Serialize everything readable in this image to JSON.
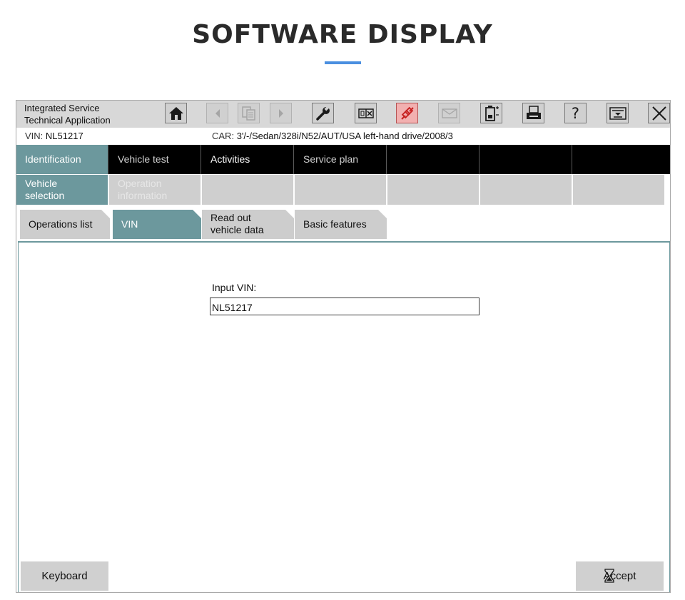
{
  "heading": "SOFTWARE DISPLAY",
  "app": {
    "title_line1": "Integrated Service",
    "title_line2": "Technical Application"
  },
  "toolbar": {
    "icons": [
      "home-icon",
      "back-icon",
      "documents-icon",
      "forward-icon",
      "wrench-icon",
      "window-close-icon",
      "connection-icon",
      "mail-icon",
      "battery-icon",
      "printer-icon",
      "help-icon",
      "dropdown-icon",
      "close-icon"
    ],
    "help_label": "?"
  },
  "info": {
    "vin_label": "VIN:",
    "vin_value": "NL51217",
    "car_label": "CAR:",
    "car_value": "3'/-/Sedan/328i/N52/AUT/USA left-hand drive/2008/3"
  },
  "main_tabs": [
    "Identification",
    "Vehicle test",
    "Activities",
    "Service plan",
    "",
    "",
    ""
  ],
  "sub_tabs": [
    {
      "line1": "Vehicle",
      "line2": "selection"
    },
    {
      "line1": "Operation",
      "line2": "information"
    }
  ],
  "folder_tabs": [
    {
      "line1": "Operations list",
      "line2": ""
    },
    {
      "line1": "VIN",
      "line2": ""
    },
    {
      "line1": "Read out",
      "line2": "vehicle data"
    },
    {
      "line1": "Basic features",
      "line2": ""
    }
  ],
  "form": {
    "vin_input_label": "Input VIN:",
    "vin_input_value": "NL51217"
  },
  "buttons": {
    "keyboard": "Keyboard",
    "accept": "Accept"
  },
  "colors": {
    "accent_teal": "#6c989d",
    "heading_underline": "#4a8fe0",
    "alert_button": "#f2b0b0"
  }
}
